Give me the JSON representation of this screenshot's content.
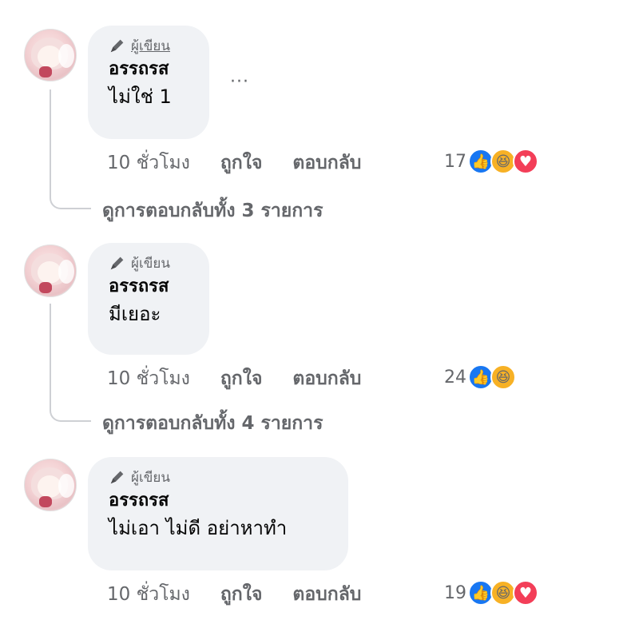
{
  "comments": [
    {
      "badge": "ผู้เขียน",
      "author": "อรรถรส",
      "text": "ไม่ใช่ 1",
      "more": "···",
      "time": "10 ชั่วโมง",
      "like": "ถูกใจ",
      "reply": "ตอบกลับ",
      "reaction_count": "17",
      "reactions": [
        "like-icon",
        "haha-icon",
        "love-icon"
      ],
      "view_replies": "ดูการตอบกลับทั้ง 3 รายการ"
    },
    {
      "badge": "ผู้เขียน",
      "author": "อรรถรส",
      "text": "มีเยอะ",
      "time": "10 ชั่วโมง",
      "like": "ถูกใจ",
      "reply": "ตอบกลับ",
      "reaction_count": "24",
      "reactions": [
        "like-icon",
        "haha-icon"
      ],
      "view_replies": "ดูการตอบกลับทั้ง 4 รายการ"
    },
    {
      "badge": "ผู้เขียน",
      "author": "อรรถรส",
      "text": "ไม่เอา ไม่ดี อย่าหาทำ",
      "time": "10 ชั่วโมง",
      "like": "ถูกใจ",
      "reply": "ตอบกลับ",
      "reaction_count": "19",
      "reactions": [
        "like-icon",
        "haha-icon",
        "love-icon"
      ]
    }
  ],
  "colors": {
    "bubble": "#f0f2f5",
    "secondary_text": "#65676b",
    "like_blue": "#1877f2",
    "haha_yellow": "#f7b125",
    "love_red": "#f33e58"
  }
}
